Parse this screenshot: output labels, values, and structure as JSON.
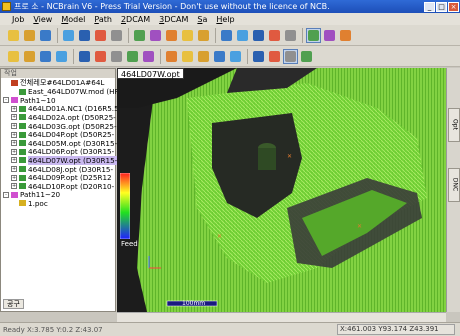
{
  "window": {
    "title": "프로 소 - NCBrain V6 - Press Trial Version - Don't use without the licence of NCB."
  },
  "menu": [
    "Job",
    "View",
    "Model",
    "Path",
    "2DCAM",
    "3DCAM",
    "Sa",
    "Help"
  ],
  "tree": {
    "title": "작업",
    "items": [
      {
        "label": "전체레모#64LD01A#64L",
        "indent": 1,
        "expander": "",
        "icon": "#c04020"
      },
      {
        "label": "East_464LD07W.mod (HRC",
        "indent": 2,
        "expander": "",
        "icon": "#3a9a3a"
      },
      {
        "label": "Path1~10",
        "indent": 1,
        "expander": "-",
        "icon": "#d050d0"
      },
      {
        "label": "464LD01A.NC1 (D16R5.5",
        "indent": 2,
        "expander": "+",
        "icon": "#3a9a3a"
      },
      {
        "label": "464LD02A.opt (D50R25-",
        "indent": 2,
        "expander": "+",
        "icon": "#3a9a3a"
      },
      {
        "label": "464LD03G.opt (D50R25-",
        "indent": 2,
        "expander": "+",
        "icon": "#3a9a3a"
      },
      {
        "label": "464LD04P.opt (D50R25-",
        "indent": 2,
        "expander": "+",
        "icon": "#3a9a3a"
      },
      {
        "label": "464LD05M.opt (D30R15-",
        "indent": 2,
        "expander": "+",
        "icon": "#3a9a3a"
      },
      {
        "label": "464LD06P.opt (D30R15-",
        "indent": 2,
        "expander": "+",
        "icon": "#3a9a3a"
      },
      {
        "label": "464LD07W.opt (D30R15-",
        "indent": 2,
        "expander": "+",
        "icon": "#3a9a3a",
        "selected": true
      },
      {
        "label": "464LD08J.opt (D30R15-",
        "indent": 2,
        "expander": "+",
        "icon": "#3a9a3a"
      },
      {
        "label": "464LD09P.opt (D25R12",
        "indent": 2,
        "expander": "+",
        "icon": "#3a9a3a"
      },
      {
        "label": "464LD10P.opt (D20R10-",
        "indent": 2,
        "expander": "+",
        "icon": "#3a9a3a"
      },
      {
        "label": "Path11~20",
        "indent": 1,
        "expander": "-",
        "icon": "#d050d0"
      },
      {
        "label": "1.poc",
        "indent": 2,
        "expander": "",
        "icon": "#d6b020"
      }
    ],
    "tab": "공구"
  },
  "viewport": {
    "title": "464LD07W.opt",
    "legend_label": "Feed",
    "scale_label": "100mm"
  },
  "dock_tabs": [
    "Opt",
    "DNC"
  ],
  "status": {
    "left": "Ready  X:3.785 Y:0.2 Z:43.07",
    "coords": "X:461.003 Y93.174 Z43.391"
  },
  "colors": {
    "toolpath": "#7fdc3a",
    "title_bar": "#1d4fb8",
    "selected": "#c9b8ef"
  },
  "toolbar1_icons": [
    "new-icon",
    "open-icon",
    "save-icon",
    "model-icon",
    "cube-icon",
    "paint-icon",
    "stop-icon",
    "undo-icon",
    "redo-icon",
    "zoom-icon",
    "rotate-icon",
    "pan-icon",
    "fit-icon",
    "view-iso-icon",
    "view-top-icon",
    "view-front-icon",
    "view-side-icon",
    "shade-icon",
    "wire-icon",
    "render-icon"
  ],
  "toolbar2_icons": [
    "folder-icon",
    "save2-icon",
    "export-icon",
    "import-icon",
    "grid-icon",
    "chart-icon",
    "print-icon",
    "layer-icon",
    "dim-icon",
    "mark-icon",
    "edit-icon",
    "check-icon",
    "color-icon",
    "path-icon",
    "tool-icon",
    "sim-icon",
    "cut-icon",
    "step-icon"
  ]
}
